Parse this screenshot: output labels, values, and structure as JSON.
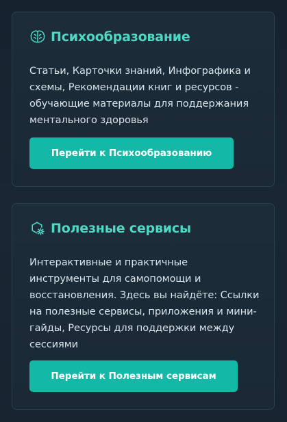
{
  "cards": [
    {
      "icon": "brain-icon",
      "title": "Психообразование",
      "description": "Статьи, Карточки знаний, Инфографика и схемы, Рекомендации книг и ресурсов - обучающие материалы для поддержания ментального здоровья",
      "button_label": "Перейти к Психообразованию"
    },
    {
      "icon": "gear-shield-icon",
      "title": "Полезные сервисы",
      "description": "Интерактивные и практичные инструменты для самопомощи и восстановления. Здесь вы найдёте: Ссылки на полезные сервисы, приложения и мини-гайды, Ресурсы для поддержки между сессиями",
      "button_label": "Перейти к Полезным сервисам"
    }
  ],
  "colors": {
    "accent": "#4fd8c4",
    "button": "#14b8a6",
    "background": "#192734",
    "card_border": "#2a4150",
    "text": "#d9e3ea"
  }
}
